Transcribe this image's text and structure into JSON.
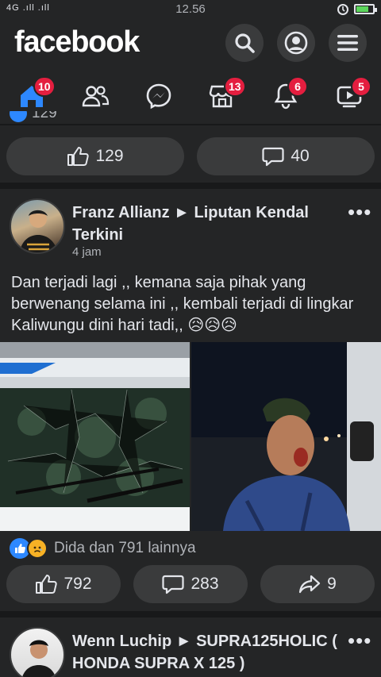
{
  "status_bar": {
    "signal_text": "4G .ıll .ıll",
    "time": "12.56",
    "battery_percent": 0.75
  },
  "header": {
    "logo": "facebook",
    "search_icon": "search-icon",
    "profile_icon": "profile-icon",
    "menu_icon": "menu-icon"
  },
  "nav": {
    "home_badge": "10",
    "marketplace_badge": "13",
    "notifications_badge": "6",
    "watch_badge": "5"
  },
  "prev_post": {
    "partial_reaction_count": "129",
    "like_count": "129",
    "comment_count": "40"
  },
  "post": {
    "author": "Franz Allianz ► Liputan Kendal Terkini",
    "time": "4 jam",
    "text": "Dan terjadi lagi ,, kemana saja pihak yang berwenang selama ini ,, kembali terjadi di lingkar Kaliwungu dini hari tadi,, 😥😥😥",
    "reactions_text": "Dida dan 791 lainnya",
    "like_count": "792",
    "comment_count": "283",
    "share_count": "9"
  },
  "next_post": {
    "author": "Wenn Luchip ► SUPRA125HOLIC ( HONDA SUPRA X 125 )"
  },
  "colors": {
    "bg": "#18191a",
    "card": "#242526",
    "pill": "#3a3b3c",
    "accent": "#2d88ff",
    "badge": "#e41e3f"
  }
}
